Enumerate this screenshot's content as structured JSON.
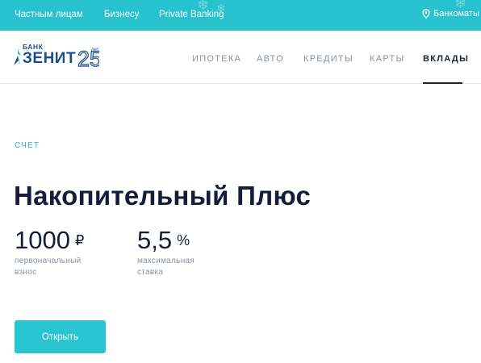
{
  "topbar": {
    "links": [
      "Частным лицам",
      "Бизнесу",
      "Private Banking"
    ],
    "atm_label": "Банкоматы"
  },
  "logo": {
    "bank": "БАНК",
    "name": "ЗЕНИТ",
    "anniversary": "25",
    "years": "лет"
  },
  "nav": {
    "items": [
      "ИПОТЕКА",
      "АВТО",
      "КРЕДИТЫ",
      "КАРТЫ",
      "ВКЛАДЫ"
    ],
    "active": "ВКЛАДЫ"
  },
  "hero": {
    "eyebrow": "СЧЕТ",
    "title": "Накопительный Плюс",
    "stats": [
      {
        "value": "1000",
        "unit": "₽",
        "caption_line1": "первоначальный",
        "caption_line2": "взнос"
      },
      {
        "value": "5,5",
        "unit": "%",
        "caption_line1": "максимальная",
        "caption_line2": "ставка"
      }
    ],
    "button_label": "Открыть"
  },
  "colors": {
    "accent": "#27c2cd",
    "button": "#29c6d1",
    "brand": "#1a4f8b",
    "title": "#161d3a"
  }
}
